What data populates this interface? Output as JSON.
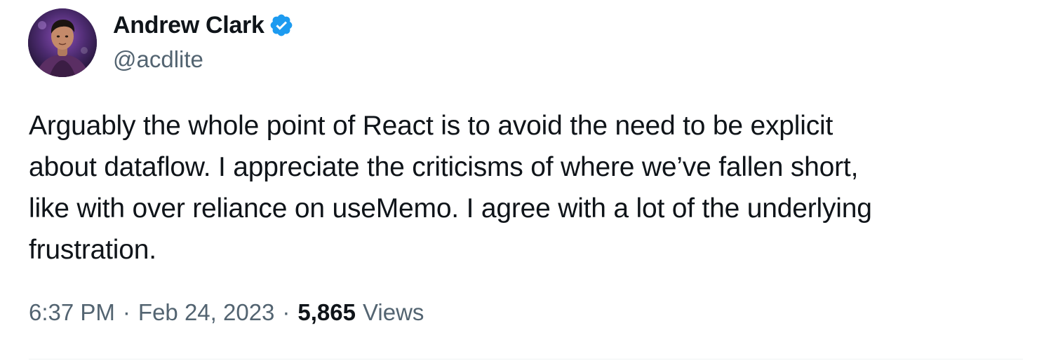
{
  "author": {
    "display_name": "Andrew Clark",
    "handle": "@acdlite",
    "verified": true,
    "verified_color": "#1d9bf0"
  },
  "tweet": {
    "text": "Arguably the whole point of React is to avoid the need to be explicit\nabout dataflow. I appreciate the criticisms of where we’ve fallen short,\nlike with over reliance on useMemo. I agree with a lot of the underlying\nfrustration."
  },
  "meta": {
    "time": "6:37 PM",
    "separator": "·",
    "date": "Feb 24, 2023",
    "views_count": "5,865",
    "views_label": "Views"
  },
  "colors": {
    "text_primary": "#0f1419",
    "text_secondary": "#536471",
    "divider": "#eff3f4"
  },
  "icons": {
    "avatar": "user-avatar-photo",
    "verified": "verified-badge-icon"
  }
}
